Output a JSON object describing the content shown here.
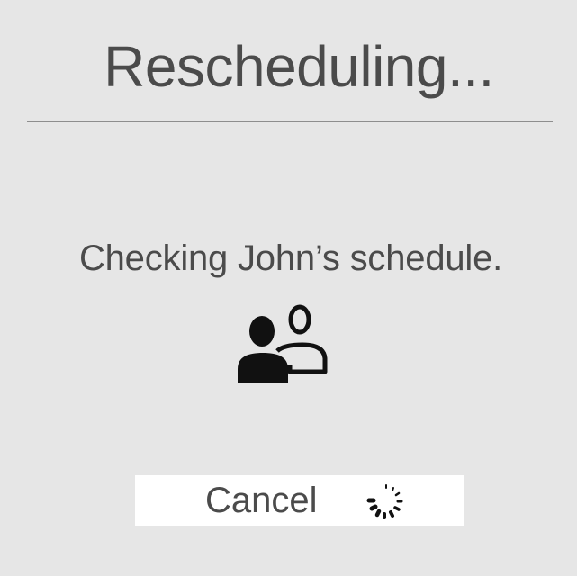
{
  "dialog": {
    "title": "Rescheduling...",
    "status_text": "Checking John’s schedule.",
    "cancel_label": "Cancel",
    "icons": {
      "contact": "contacts-icon",
      "loading": "loading-spinner-icon"
    }
  }
}
